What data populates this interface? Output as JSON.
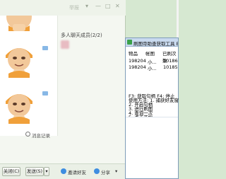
{
  "chat_window": {
    "title": "举报",
    "member_header": "多人聊天成员(2/2)",
    "history_label": "消息记录",
    "bottom": {
      "close_label": "关闭(C)",
      "send_label": "发送(S)",
      "invite_label": "邀请好友",
      "share_label": "分享"
    }
  },
  "tool_window": {
    "title": "刷图帝助查获取工具 By",
    "columns": [
      "物品",
      "帐图",
      "已刷次数"
    ],
    "rows": [
      [
        "198204",
        "小...",
        "10186"
      ],
      [
        "198204",
        "小...",
        "10185"
      ]
    ],
    "help_lines": [
      "F3: 获取句柄  F4: 停止",
      "使用方法: 1.   捕获好友窗",
      "               2.   开启句柄",
      "               3.   进行刷图",
      "               4.   查询一次",
      "               5.   点击开始"
    ]
  }
}
